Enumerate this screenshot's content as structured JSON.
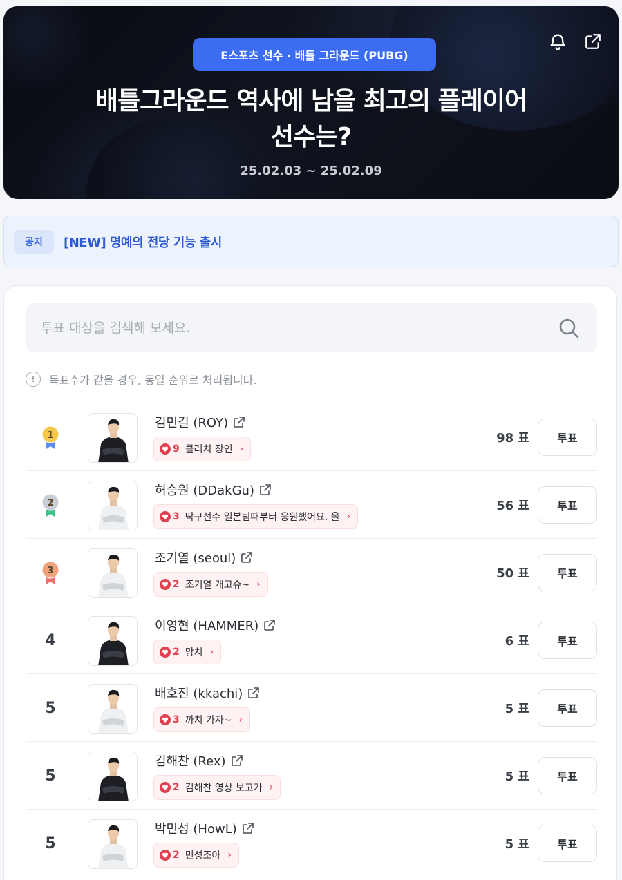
{
  "hero": {
    "category": "E스포츠 선수 · 배틀 그라운드 (PUBG)",
    "title_line1": "배틀그라운드 역사에 남을 최고의 플레이어",
    "title_line2": "선수는?",
    "period": "25.02.03 ~ 25.02.09",
    "icons": [
      "bell-icon",
      "share-icon"
    ]
  },
  "notice": {
    "tag": "공지",
    "text": "[NEW] 명예의 전당 기능 출시"
  },
  "search": {
    "placeholder": "투표 대상을 검색해 보세요."
  },
  "info": {
    "text": "득표수가 같을 경우, 동일 순위로 처리됩니다."
  },
  "colors": {
    "accent": "#3b6cf2",
    "gold": "#f5c84a",
    "silver": "#c9ced6",
    "bronze": "#f0a27a",
    "heart": "#e0404f",
    "medal_ribbon_blue": "#5b8ef0",
    "medal_ribbon_green": "#3cc28b",
    "medal_ribbon_red": "#ef6f6f"
  },
  "players": [
    {
      "rank": "1",
      "medal": "gold",
      "name": "김민길 (ROY)",
      "comment_count": "9",
      "comment": "클러치 장인",
      "votes": "98 표",
      "vote_label": "투표",
      "jersey": "dark"
    },
    {
      "rank": "2",
      "medal": "silver",
      "name": "허승원 (DDakGu)",
      "comment_count": "3",
      "comment": "딱구선수 일본팀때부터 응원했어요. 올",
      "votes": "56 표",
      "vote_label": "투표",
      "jersey": "light"
    },
    {
      "rank": "3",
      "medal": "bronze",
      "name": "조기열 (seoul)",
      "comment_count": "2",
      "comment": "조기열 개고슈~",
      "votes": "50 표",
      "vote_label": "투표",
      "jersey": "light"
    },
    {
      "rank": "4",
      "medal": "",
      "name": "이영현 (HAMMER)",
      "comment_count": "2",
      "comment": "망치",
      "votes": "6 표",
      "vote_label": "투표",
      "jersey": "dark"
    },
    {
      "rank": "5",
      "medal": "",
      "name": "배호진 (kkachi)",
      "comment_count": "3",
      "comment": "까치 가자~",
      "votes": "5 표",
      "vote_label": "투표",
      "jersey": "light"
    },
    {
      "rank": "5",
      "medal": "",
      "name": "김해찬 (Rex)",
      "comment_count": "2",
      "comment": "김해찬 영상 보고가",
      "votes": "5 표",
      "vote_label": "투표",
      "jersey": "dark"
    },
    {
      "rank": "5",
      "medal": "",
      "name": "박민성 (HowL)",
      "comment_count": "2",
      "comment": "민성조아",
      "votes": "5 표",
      "vote_label": "투표",
      "jersey": "light"
    }
  ]
}
